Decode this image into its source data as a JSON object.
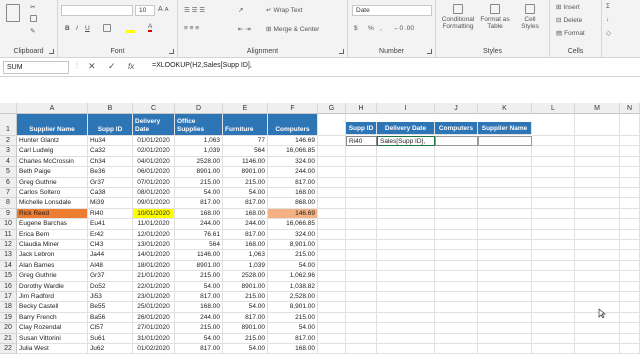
{
  "ribbon": {
    "font_size": "10",
    "wrap_text": "Wrap Text",
    "merge_center": "Merge & Center",
    "number_format": "Date",
    "conditional_formatting": "Conditional Formatting",
    "format_as_table": "Format as Table",
    "cell_styles": "Cell Styles",
    "insert": "Insert",
    "delete": "Delete",
    "format": "Format",
    "groups": {
      "clipboard": "Clipboard",
      "font": "Font",
      "alignment": "Alignment",
      "number": "Number",
      "styles": "Styles",
      "cells": "Cells"
    },
    "bold": "B",
    "italic": "I",
    "underline": "U",
    "pct": "%",
    "comma": ",",
    "dollar": "$"
  },
  "formula_bar": {
    "name_box": "SUM",
    "cancel": "✕",
    "enter": "✓",
    "fx": "fx",
    "formula": "=XLOOKUP(H2,Sales[Supp ID],"
  },
  "columns": [
    "A",
    "B",
    "C",
    "D",
    "E",
    "F",
    "G",
    "H",
    "I",
    "J",
    "K",
    "L",
    "M",
    "N"
  ],
  "headers": {
    "supplier": "Supplier Name",
    "supp_id": "Supp ID",
    "delivery": "Delivery Date",
    "office": "Office Supplies",
    "furniture": "Furniture",
    "computers": "Computers"
  },
  "lookup_headers": {
    "supp_id": "Supp ID",
    "delivery": "Delivery Date",
    "computers": "Computers",
    "supplier": "Supplier Name"
  },
  "lookup_row": {
    "supp_id": "Ri40",
    "delivery": "Sales[Supp ID],"
  },
  "rows": [
    [
      "Hunter Glantz",
      "Hu34",
      "01/01/2020",
      "1,063",
      "77",
      "146.69"
    ],
    [
      "Carl Ludwig",
      "Ca32",
      "02/01/2020",
      "1,039",
      "564",
      "16,066.85"
    ],
    [
      "Charles McCrossin",
      "Ch34",
      "04/01/2020",
      "2528.00",
      "1146.00",
      "324.00"
    ],
    [
      "Beth Paige",
      "Be36",
      "06/01/2020",
      "8901.00",
      "8901.00",
      "244.00"
    ],
    [
      "Greg Guthrie",
      "Gr37",
      "07/01/2020",
      "215.00",
      "215.00",
      "817.00"
    ],
    [
      "Carlos Soltero",
      "Ca38",
      "08/01/2020",
      "54.00",
      "54.00",
      "168.00"
    ],
    [
      "Michelle Lonsdale",
      "Mi39",
      "09/01/2020",
      "817.00",
      "817.00",
      "868.00"
    ],
    [
      "Rick Reed",
      "Ri40",
      "10/01/2020",
      "168.00",
      "168.00",
      "146.69"
    ],
    [
      "Eugene Barchas",
      "Eu41",
      "11/01/2020",
      "244.00",
      "244.00",
      "16,066.85"
    ],
    [
      "Erica Bern",
      "Er42",
      "12/01/2020",
      "76.61",
      "817.00",
      "324.00"
    ],
    [
      "Claudia Miner",
      "Cl43",
      "13/01/2020",
      "564",
      "168.00",
      "8,901.00"
    ],
    [
      "Jack Lebron",
      "Ja44",
      "14/01/2020",
      "1146.00",
      "1,063",
      "215.00"
    ],
    [
      "Alan Barnes",
      "Al48",
      "18/01/2020",
      "8901.00",
      "1,039",
      "54.00"
    ],
    [
      "Greg Guthrie",
      "Gr37",
      "21/01/2020",
      "215.00",
      "2528.00",
      "1,062.96"
    ],
    [
      "Dorothy Wardle",
      "Do52",
      "22/01/2020",
      "54.00",
      "8901.00",
      "1,038.82"
    ],
    [
      "Jim Radford",
      "Ji53",
      "23/01/2020",
      "817.00",
      "215.00",
      "2,528.00"
    ],
    [
      "Becky Castell",
      "Be55",
      "25/01/2020",
      "168.00",
      "54.00",
      "8,901.00"
    ],
    [
      "Barry French",
      "Ba56",
      "26/01/2020",
      "244.00",
      "817.00",
      "215.00"
    ],
    [
      "Clay Rozendal",
      "Cl57",
      "27/01/2020",
      "215.00",
      "8901.00",
      "54.00"
    ],
    [
      "Susan Vittorini",
      "Su61",
      "31/01/2020",
      "54.00",
      "215.00",
      "817.00"
    ],
    [
      "Julia West",
      "Ju62",
      "01/02/2020",
      "817.00",
      "54.00",
      "168.00"
    ]
  ],
  "colors": {
    "header_blue": "#2e75b6",
    "highlight_row": "#ed7d31",
    "highlight_date": "#ffff00",
    "highlight_computers": "#f4b183"
  }
}
